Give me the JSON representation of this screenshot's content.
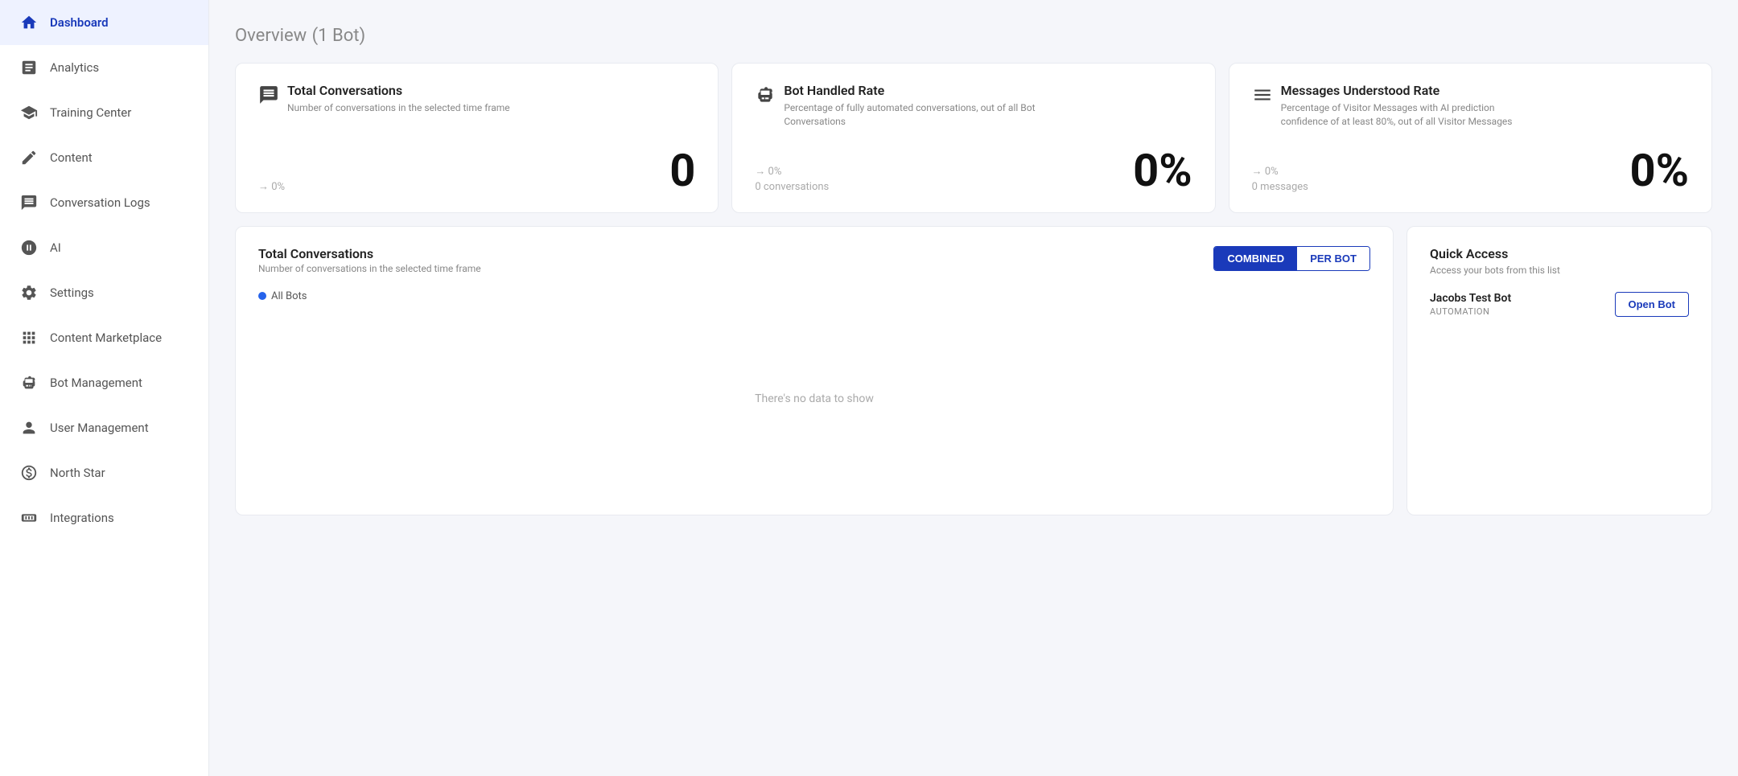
{
  "page": {
    "title": "Overview",
    "bot_count": "(1 Bot)"
  },
  "sidebar": {
    "items": [
      {
        "id": "dashboard",
        "label": "Dashboard",
        "icon": "home",
        "active": true
      },
      {
        "id": "analytics",
        "label": "Analytics",
        "icon": "analytics",
        "active": false
      },
      {
        "id": "training-center",
        "label": "Training Center",
        "icon": "training",
        "active": false
      },
      {
        "id": "content",
        "label": "Content",
        "icon": "content",
        "active": false
      },
      {
        "id": "conversation-logs",
        "label": "Conversation Logs",
        "icon": "chat",
        "active": false
      },
      {
        "id": "ai",
        "label": "AI",
        "icon": "ai",
        "active": false
      },
      {
        "id": "settings",
        "label": "Settings",
        "icon": "settings",
        "active": false
      },
      {
        "id": "content-marketplace",
        "label": "Content Marketplace",
        "icon": "marketplace",
        "active": false
      },
      {
        "id": "bot-management",
        "label": "Bot Management",
        "icon": "bot",
        "active": false
      },
      {
        "id": "user-management",
        "label": "User Management",
        "icon": "users",
        "active": false
      },
      {
        "id": "north-star",
        "label": "North Star",
        "icon": "northstar",
        "active": false
      },
      {
        "id": "integrations",
        "label": "Integrations",
        "icon": "integrations",
        "active": false
      }
    ]
  },
  "stats": [
    {
      "title": "Total Conversations",
      "description": "Number of conversations in the selected time frame",
      "change": "→ 0%",
      "value": "0",
      "sub": "",
      "icon": "chat-lines"
    },
    {
      "title": "Bot Handled Rate",
      "description": "Percentage of fully automated conversations, out of all Bot Conversations",
      "change": "→ 0%",
      "value": "0%",
      "sub": "0 conversations",
      "icon": "bot-face"
    },
    {
      "title": "Messages Understood Rate",
      "description": "Percentage of Visitor Messages with AI prediction confidence of at least 80%, out of all Visitor Messages",
      "change": "→ 0%",
      "value": "0%",
      "sub": "0 messages",
      "icon": "lines-chart"
    }
  ],
  "chart": {
    "title": "Total Conversations",
    "description": "Number of conversations in the selected time frame",
    "toggle_combined": "COMBINED",
    "toggle_per_bot": "PER BOT",
    "legend_label": "All Bots",
    "empty_text": "There's no data to show"
  },
  "quick_access": {
    "title": "Quick Access",
    "description": "Access your bots from this list",
    "bots": [
      {
        "name": "Jacobs Test Bot",
        "type": "AUTOMATION",
        "button_label": "Open Bot"
      }
    ]
  }
}
